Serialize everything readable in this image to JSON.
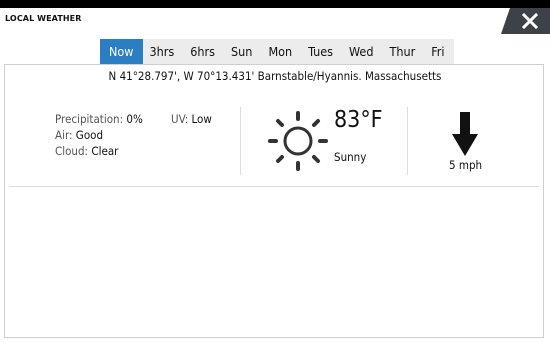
{
  "window": {
    "title": "LOCAL WEATHER",
    "close_icon": "close-icon"
  },
  "tabs": [
    {
      "label": "Now",
      "active": true
    },
    {
      "label": "3hrs",
      "active": false
    },
    {
      "label": "6hrs",
      "active": false
    },
    {
      "label": "Sun",
      "active": false
    },
    {
      "label": "Mon",
      "active": false
    },
    {
      "label": "Tues",
      "active": false
    },
    {
      "label": "Wed",
      "active": false
    },
    {
      "label": "Thur",
      "active": false
    },
    {
      "label": "Fri",
      "active": false
    }
  ],
  "location": "N 41°28.797', W 70°13.431'  Barnstable/Hyannis. Massachusetts",
  "details": {
    "precipitation_label": "Precipitation:",
    "precipitation_value": "0%",
    "air_label": "Air:",
    "air_value": "Good",
    "cloud_label": "Cloud:",
    "cloud_value": "Clear",
    "uv_label": "UV:",
    "uv_value": "Low"
  },
  "current": {
    "icon": "sun-icon",
    "temperature": "83°F",
    "condition": "Sunny"
  },
  "wind": {
    "icon": "wind-direction-arrow-icon",
    "speed": "5 mph"
  },
  "colors": {
    "accent": "#2c7ec2",
    "tab_bg": "#ececec",
    "close_bg": "#3e4148"
  }
}
